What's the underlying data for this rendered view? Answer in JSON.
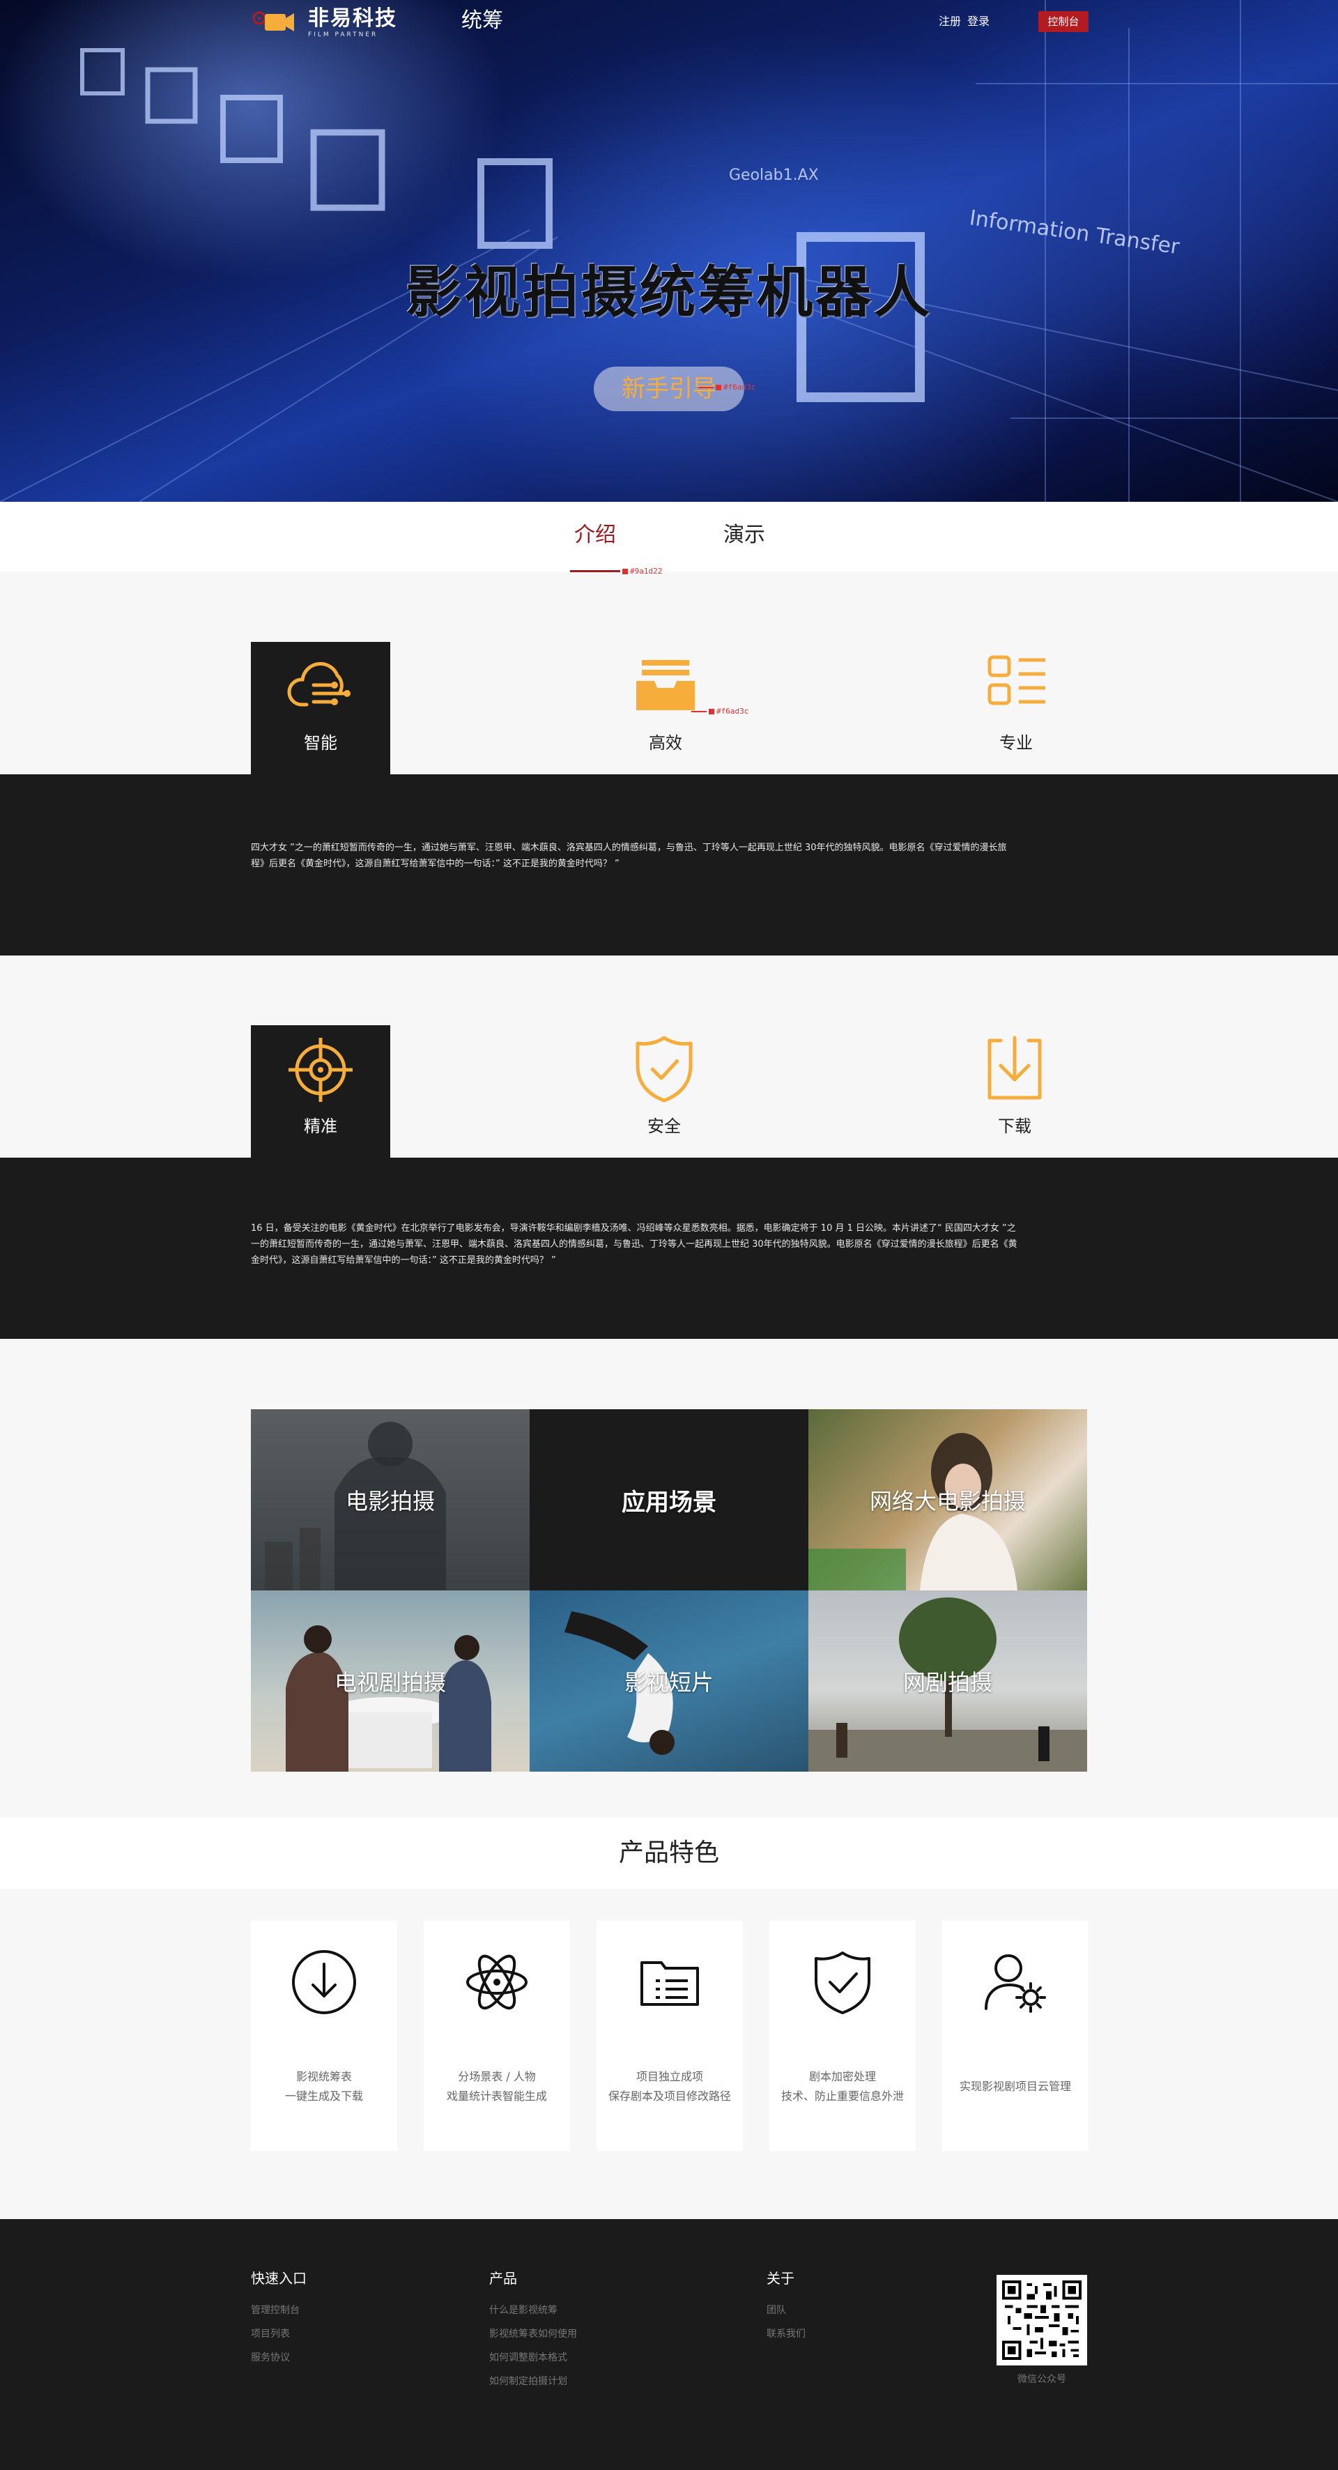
{
  "header": {
    "logo_cn": "非易科技",
    "logo_en": "FILM PARTNER",
    "nav_title": "统筹",
    "register": "注册",
    "login": "登录",
    "console": "控制台"
  },
  "hero": {
    "title": "影视拍摄统筹机器人",
    "guide_button": "新手引导",
    "guide_color_annotation": "#f6ad3c",
    "background_text": [
      "Geolab1.AX",
      "Information Transfer"
    ]
  },
  "tabs": {
    "items": [
      "介绍",
      "演示"
    ],
    "active_color_annotation": "#9a1d22"
  },
  "features_row1": {
    "items": [
      "智能",
      "高效",
      "专业"
    ],
    "icon_color_annotation": "#f6ad3c",
    "description": "四大才女 ”之一的萧红短暂而传奇的一生，通过她与萧军、汪恩甲、端木蕻良、洛宾基四人的情感纠葛，与鲁迅、丁玲等人一起再现上世纪 30年代的独特风貌。电影原名《穿过爱情的漫长旅程》后更名《黄金时代》，这源自萧红写给萧军信中的一句话：” 这不正是我的黄金时代吗？ ”"
  },
  "features_row2": {
    "items": [
      "精准",
      "安全",
      "下载"
    ],
    "description": "16 日，备受关注的电影《黄金时代》在北京举行了电影发布会，导演许鞍华和编剧李樯及汤唯、冯绍峰等众星悉数亮相。据悉，电影确定将于 10 月 1 日公映。本片讲述了“ 民国四大才女 ”之一的萧红短暂而传奇的一生，通过她与萧军、汪恩甲、端木蕻良、洛宾基四人的情感纠葛，与鲁迅、丁玲等人一起再现上世纪 30年代的独特风貌。电影原名《穿过爱情的漫长旅程》后更名《黄金时代》，这源自萧红写给萧军信中的一句话：” 这不正是我的黄金时代吗？ ”"
  },
  "scenes": {
    "tiles": [
      "电影拍摄",
      "应用场景",
      "网络大电影拍摄",
      "电视剧拍摄",
      "影视短片",
      "网剧拍摄"
    ]
  },
  "product_features": {
    "title": "产品特色",
    "cards": [
      {
        "line1": "影视统筹表",
        "line2": "一键生成及下载",
        "icon": "download-circle-icon"
      },
      {
        "line1": "分场景表 / 人物",
        "line2": "戏量统计表智能生成",
        "icon": "atom-icon"
      },
      {
        "line1": "项目独立成项",
        "line2": "保存剧本及项目修改路径",
        "icon": "folder-list-icon"
      },
      {
        "line1": "剧本加密处理",
        "line2": "技术、防止重要信息外泄",
        "icon": "shield-check-icon"
      },
      {
        "line1": "实现影视剧项目云管理",
        "line2": "",
        "icon": "user-gear-icon"
      }
    ]
  },
  "footer": {
    "quick": {
      "title": "快速入口",
      "links": [
        "管理控制台",
        "项目列表",
        "服务协议"
      ]
    },
    "product": {
      "title": "产品",
      "links": [
        "什么是影视统筹",
        "影视统筹表如何使用",
        "如何调整剧本格式",
        "如何制定拍摄计划"
      ]
    },
    "about": {
      "title": "关于",
      "links": [
        "团队",
        "联系我们"
      ]
    },
    "qr_caption": "微信公众号"
  },
  "colors": {
    "accent": "#f6ad3c",
    "brand_red": "#9a1d22",
    "console_red": "#b31b21",
    "dark": "#1b1b1b"
  }
}
